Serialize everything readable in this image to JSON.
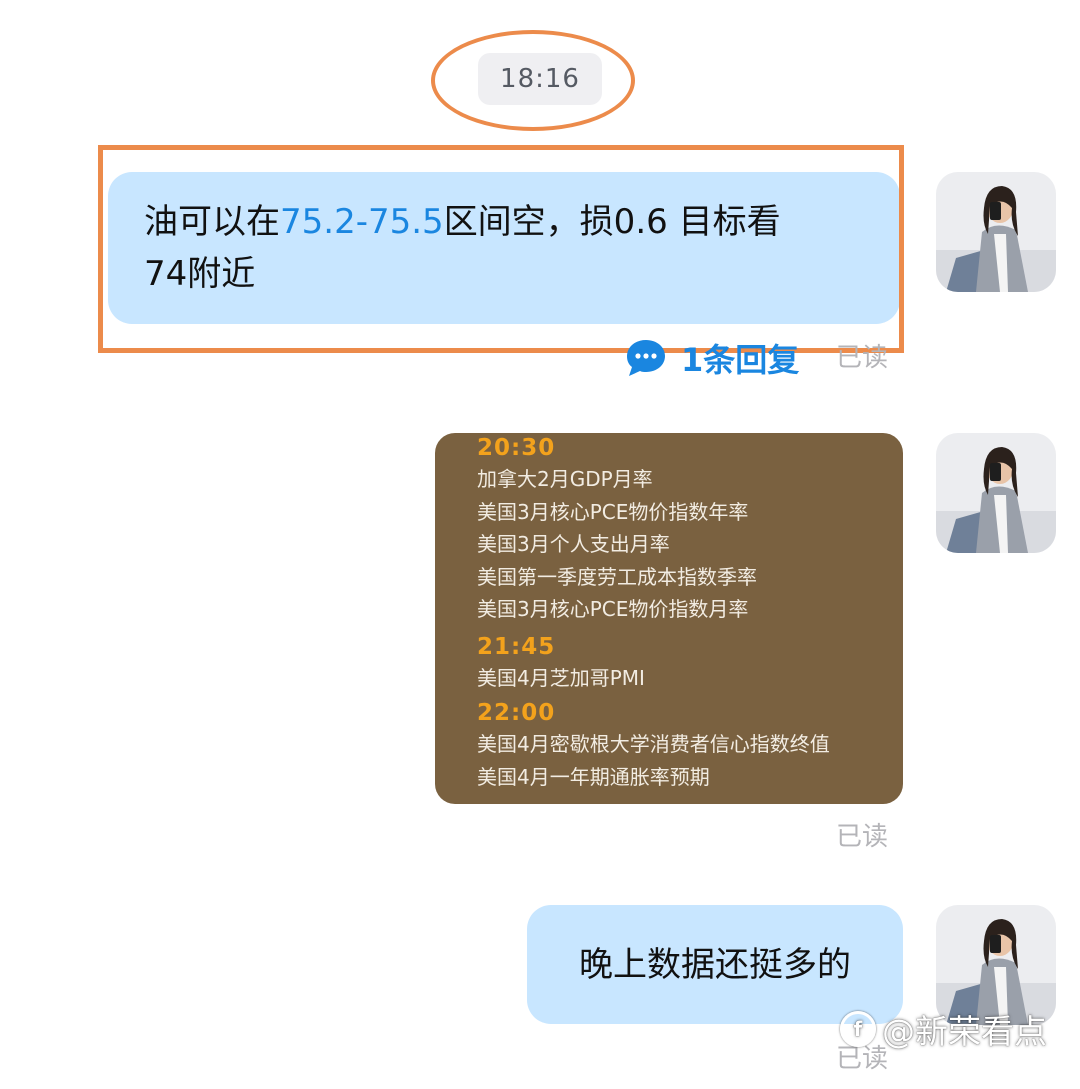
{
  "timestamp": "18:16",
  "messages": [
    {
      "text_parts": [
        "油可以在",
        "75.2-75.5",
        "区间空，损0.6  目标看",
        "74附近"
      ],
      "reply": {
        "label": "1条回复",
        "icon": "chat-bubble-icon"
      },
      "status": "已读"
    },
    {
      "image": {
        "schedule": [
          {
            "time": "20:30",
            "items": [
              "加拿大2月GDP月率",
              "美国3月核心PCE物价指数年率",
              "美国3月个人支出月率",
              "美国第一季度劳工成本指数季率",
              "美国3月核心PCE物价指数月率"
            ]
          },
          {
            "time": "21:45",
            "items": [
              "美国4月芝加哥PMI"
            ]
          },
          {
            "time": "22:00",
            "items": [
              "美国4月密歇根大学消费者信心指数终值",
              "美国4月一年期通胀率预期"
            ]
          }
        ]
      },
      "status": "已读"
    },
    {
      "text": "晚上数据还挺多的",
      "status": "已读"
    }
  ],
  "watermark": {
    "text": "@新荣看点"
  },
  "colors": {
    "bubble": "#c8e6ff",
    "highlight": "#1a86e0",
    "annotation": "#ec8b4b",
    "image_bg": "#7a6140",
    "schedule_time": "#f3a21c"
  }
}
